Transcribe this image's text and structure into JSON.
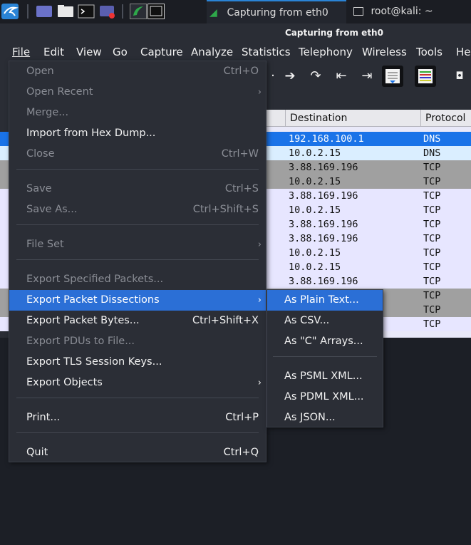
{
  "taskbar": {
    "tasks": [
      {
        "label": "Capturing from eth0"
      },
      {
        "label": "root@kali: ~"
      }
    ]
  },
  "window": {
    "title": "Capturing from eth0"
  },
  "menubar": [
    "File",
    "Edit",
    "View",
    "Go",
    "Capture",
    "Analyze",
    "Statistics",
    "Telephony",
    "Wireless",
    "Tools",
    "Hel"
  ],
  "packet_list": {
    "columns": [
      "Destination",
      "Protocol"
    ],
    "rows": [
      {
        "destination": "192.168.100.1",
        "protocol": "DNS",
        "bg": "#1a73e8",
        "fg": "#ffffff"
      },
      {
        "destination": "10.0.2.15",
        "protocol": "DNS",
        "bg": "#daeeff",
        "fg": "#111111"
      },
      {
        "destination": "3.88.169.196",
        "protocol": "TCP",
        "bg": "#a0a0a0",
        "fg": "#111111"
      },
      {
        "destination": "10.0.2.15",
        "protocol": "TCP",
        "bg": "#a0a0a0",
        "fg": "#111111"
      },
      {
        "destination": "3.88.169.196",
        "protocol": "TCP",
        "bg": "#e7e6ff",
        "fg": "#111111"
      },
      {
        "destination": "10.0.2.15",
        "protocol": "TCP",
        "bg": "#e7e6ff",
        "fg": "#111111"
      },
      {
        "destination": "3.88.169.196",
        "protocol": "TCP",
        "bg": "#e7e6ff",
        "fg": "#111111"
      },
      {
        "destination": "3.88.169.196",
        "protocol": "TCP",
        "bg": "#e7e6ff",
        "fg": "#111111"
      },
      {
        "destination": "10.0.2.15",
        "protocol": "TCP",
        "bg": "#e7e6ff",
        "fg": "#111111"
      },
      {
        "destination": "10.0.2.15",
        "protocol": "TCP",
        "bg": "#e7e6ff",
        "fg": "#111111"
      },
      {
        "destination": "3.88.169.196",
        "protocol": "TCP",
        "bg": "#e7e6ff",
        "fg": "#111111"
      },
      {
        "destination": "",
        "protocol": "TCP",
        "bg": "#a0a0a0",
        "fg": "#111111"
      },
      {
        "destination": "",
        "protocol": "TCP",
        "bg": "#a0a0a0",
        "fg": "#111111"
      },
      {
        "destination": "",
        "protocol": "TCP",
        "bg": "#e7e6ff",
        "fg": "#111111"
      }
    ]
  },
  "file_menu": {
    "items": [
      {
        "label": "Open",
        "shortcut": "Ctrl+O",
        "disabled": true
      },
      {
        "label": "Open Recent",
        "shortcut": "",
        "disabled": true,
        "submenu": true
      },
      {
        "label": "Merge...",
        "shortcut": "",
        "disabled": true
      },
      {
        "label": "Import from Hex Dump...",
        "shortcut": "",
        "disabled": false
      },
      {
        "label": "Close",
        "shortcut": "Ctrl+W",
        "disabled": true
      },
      {
        "label": "Save",
        "shortcut": "Ctrl+S",
        "disabled": true
      },
      {
        "label": "Save As...",
        "shortcut": "Ctrl+Shift+S",
        "disabled": true
      },
      {
        "label": "File Set",
        "shortcut": "",
        "disabled": true,
        "submenu": true
      },
      {
        "label": "Export Specified Packets...",
        "shortcut": "",
        "disabled": true
      },
      {
        "label": "Export Packet Dissections",
        "shortcut": "",
        "disabled": false,
        "submenu": true,
        "highlighted": true
      },
      {
        "label": "Export Packet Bytes...",
        "shortcut": "Ctrl+Shift+X",
        "disabled": false
      },
      {
        "label": "Export PDUs to File...",
        "shortcut": "",
        "disabled": true
      },
      {
        "label": "Export TLS Session Keys...",
        "shortcut": "",
        "disabled": false
      },
      {
        "label": "Export Objects",
        "shortcut": "",
        "disabled": false,
        "submenu": true
      },
      {
        "label": "Print...",
        "shortcut": "Ctrl+P",
        "disabled": false
      },
      {
        "label": "Quit",
        "shortcut": "Ctrl+Q",
        "disabled": false
      }
    ]
  },
  "export_submenu": {
    "items": [
      {
        "label": "As Plain Text...",
        "highlighted": true
      },
      {
        "label": "As CSV..."
      },
      {
        "label": "As \"C\" Arrays..."
      },
      {
        "label": "As PSML XML..."
      },
      {
        "label": "As PDML XML..."
      },
      {
        "label": "As JSON..."
      }
    ]
  },
  "colors": {
    "accent": "#2b6fd6",
    "menu_bg": "#2b2e36",
    "disabled_text": "#8a8d95"
  }
}
